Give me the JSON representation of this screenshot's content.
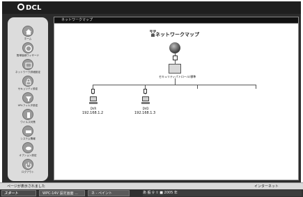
{
  "app": {
    "logo_text": "DCL"
  },
  "sidebar": {
    "items": [
      {
        "label": "ホーム",
        "icon": "home-icon"
      },
      {
        "label": "簡単接続ウィザード",
        "icon": "wizard-icon"
      },
      {
        "label": "ネットワーク詳細設定",
        "icon": "network-icon"
      },
      {
        "label": "セキュリティ設定",
        "icon": "security-icon"
      },
      {
        "label": "URLフィルタ設定",
        "icon": "filter-icon"
      },
      {
        "label": "ウイルス対策",
        "icon": "virus-icon"
      },
      {
        "label": "システム情報",
        "icon": "info-icon"
      },
      {
        "label": "オプション設定",
        "icon": "options-icon"
      },
      {
        "label": "ログアウト",
        "icon": "logout-icon"
      }
    ]
  },
  "content": {
    "title_bar": "ネットワークマップ",
    "map_title": "ネットワークマップ",
    "router_label": "セキュリティパトロール/標準",
    "devices": [
      {
        "name": "DVR",
        "ip": "192.168.1.2"
      },
      {
        "name": "DVD",
        "ip": "192.168.1.3"
      }
    ]
  },
  "status": {
    "left": "ページが表示されました",
    "right": "インターネット"
  },
  "taskbar": {
    "start_label": "スタート",
    "tasks": [
      "WPC-14V 設定画面 ...",
      "ネ - ペイント"
    ],
    "tray_text": "あ 般 ♀ ⇧ ■  2005 年"
  },
  "colors": {
    "dark_frame": "#2c2c2c",
    "nav_bg": "#dcdcdc",
    "content_bg": "#ffffff",
    "taskbar": "#303030"
  }
}
